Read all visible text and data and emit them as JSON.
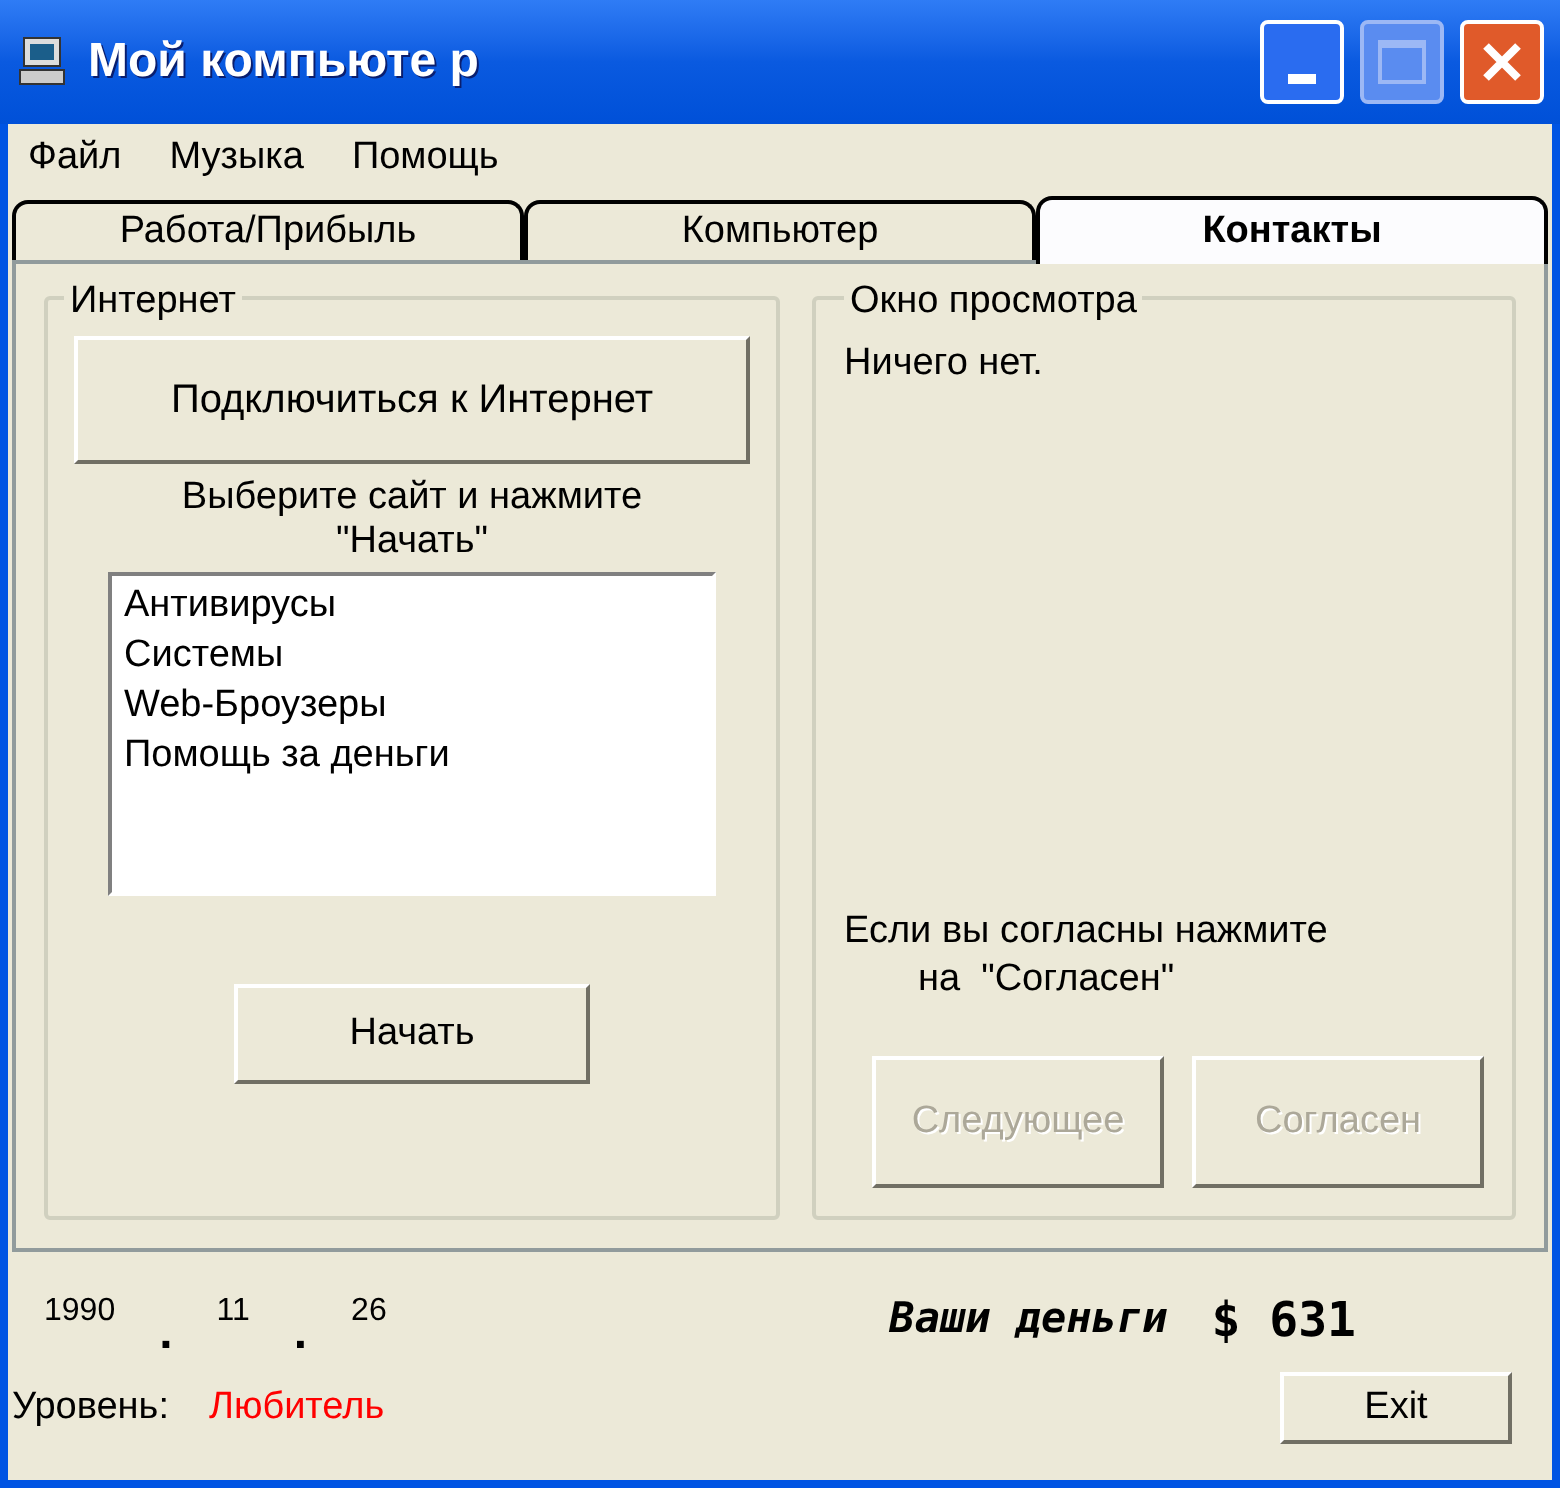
{
  "window": {
    "title": "Мой компьюте р"
  },
  "menu": [
    "Файл",
    "Музыка",
    "Помощь"
  ],
  "tabs": [
    {
      "label": "Работа/Прибыль",
      "selected": false
    },
    {
      "label": "Компьютер",
      "selected": false
    },
    {
      "label": "Контакты",
      "selected": true
    }
  ],
  "internet": {
    "title": "Интернет",
    "connect_button": "Подключиться к Интернет",
    "instruction": "Выберите сайт и нажмите\n\"Начать\"",
    "sites": [
      {
        "label": "Антивирусы",
        "selected": false
      },
      {
        "label": "Системы",
        "selected": false
      },
      {
        "label": "Web-Броузеры",
        "selected": false
      },
      {
        "label": "Помощь за деньги",
        "selected": false
      }
    ],
    "start_button": "Начать"
  },
  "preview": {
    "title": "Окно просмотра",
    "text": "Ничего нет.",
    "prompt": "Если вы согласны нажмите\n       на  \"Согласен\"",
    "buttons": [
      {
        "label": "Следующее",
        "disabled": true
      },
      {
        "label": "Согласен",
        "disabled": true
      }
    ]
  },
  "status": {
    "date": [
      "1990",
      ".",
      "11",
      ".",
      "26"
    ],
    "money_label": "Ваши деньги",
    "money": "$ 631",
    "level_label": "Уровень:",
    "level": "Любитель",
    "exit_button": "Exit"
  }
}
